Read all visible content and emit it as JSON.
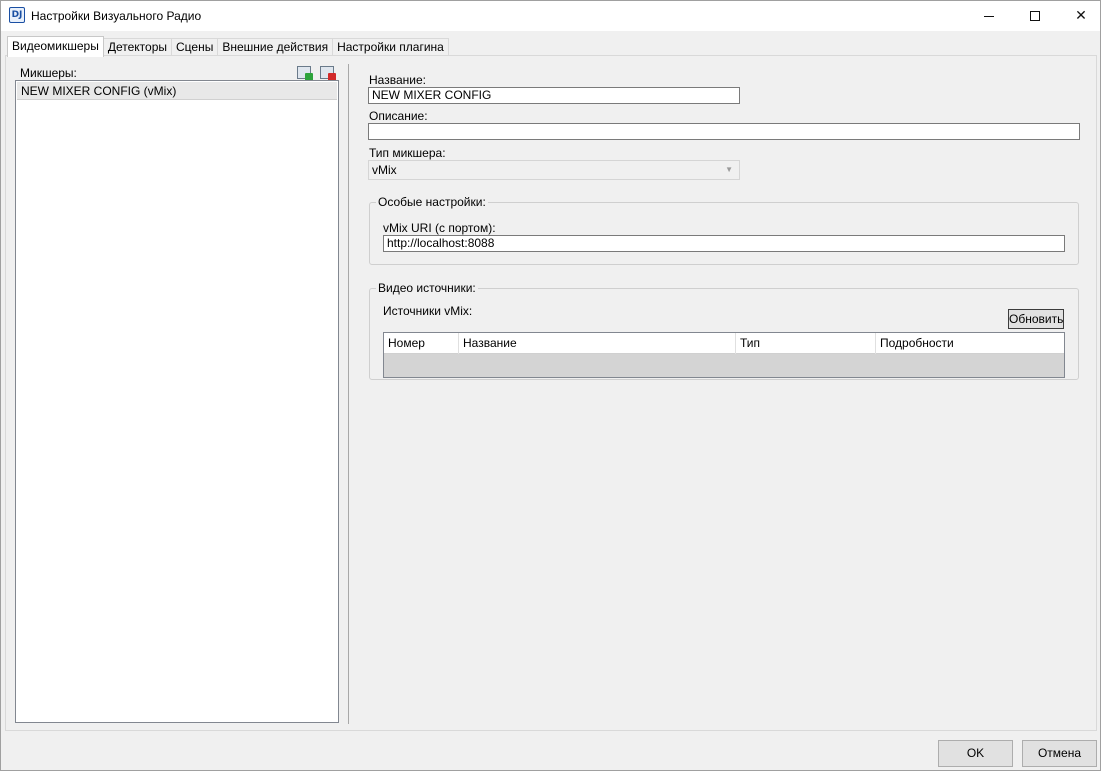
{
  "window": {
    "title": "Настройки Визуального Радио",
    "icon_text": "DJ",
    "close_glyph": "✕"
  },
  "tabs": [
    {
      "label": "Видеомикшеры",
      "active": true
    },
    {
      "label": "Детекторы",
      "active": false
    },
    {
      "label": "Сцены",
      "active": false
    },
    {
      "label": "Внешние действия",
      "active": false
    },
    {
      "label": "Настройки плагина",
      "active": false
    }
  ],
  "mixers": {
    "label": "Микшеры:",
    "items": [
      "NEW MIXER CONFIG (vMix)"
    ]
  },
  "form": {
    "name_label": "Название:",
    "name_value": "NEW MIXER CONFIG",
    "description_label": "Описание:",
    "description_value": "",
    "mixer_type_label": "Тип микшера:",
    "mixer_type_value": "vMix"
  },
  "special_settings": {
    "title": "Особые настройки:",
    "uri_label": "vMix URI (с портом):",
    "uri_value": "http://localhost:8088"
  },
  "video_sources": {
    "title": "Видео источники:",
    "sources_label": "Источники vMix:",
    "refresh_button": "Обновить",
    "columns": [
      "Номер",
      "Название",
      "Тип",
      "Подробности"
    ]
  },
  "footer": {
    "ok": "OK",
    "cancel": "Отмена"
  }
}
